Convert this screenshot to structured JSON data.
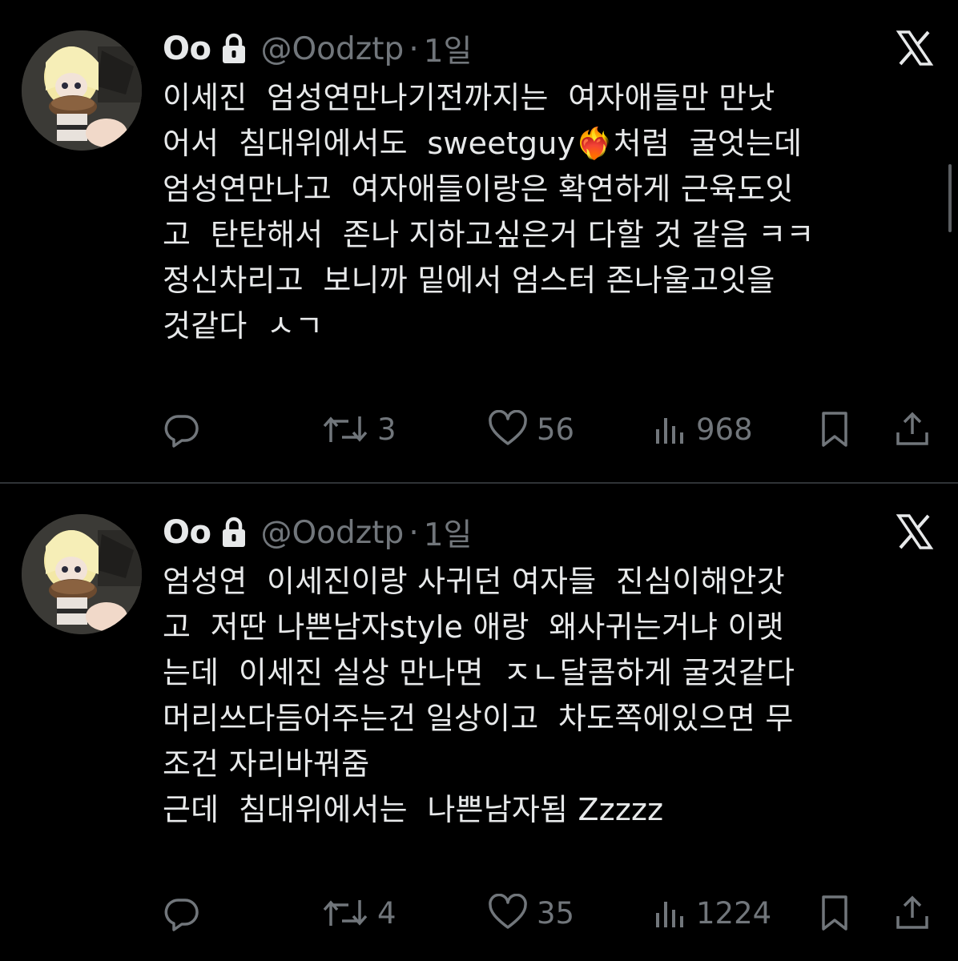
{
  "colors": {
    "background": "#000000",
    "text": "#e7e9ea",
    "muted": "#71767b",
    "divider": "#2f3336"
  },
  "tweets": [
    {
      "display_name": "Oo",
      "handle": "@Oodztp",
      "separator": "·",
      "time": "1일",
      "lines": [
        "이세진  엄성연만나기전까지는  여자애들만 만낫",
        "어서  침대위에서도  sweetguy❤️‍🔥처럼  굴엇는데",
        "엄성연만나고  여자애들이랑은 확연하게 근육도잇",
        "고  탄탄해서  존나 지하고싶은거 다할 것 같음 ㅋㅋ",
        "정신차리고  보니까 밑에서 엄스터 존나울고잇을",
        "것같다  ㅅㄱ"
      ],
      "stats": {
        "replies": "",
        "retweets": "3",
        "likes": "56",
        "views": "968"
      }
    },
    {
      "display_name": "Oo",
      "handle": "@Oodztp",
      "separator": "·",
      "time": "1일",
      "lines": [
        "엄성연  이세진이랑 사귀던 여자들  진심이해안갓",
        "고  저딴 나쁜남자style 애랑  왜사귀는거냐 이랫",
        "는데  이세진 실상 만나면  ㅈㄴ달콤하게 굴것같다",
        "머리쓰다듬어주는건 일상이고  차도쪽에있으면 무",
        "조건 자리바꿔줌",
        "근데  침대위에서는  나쁜남자됨 Zzzzz"
      ],
      "stats": {
        "replies": "",
        "retweets": "4",
        "likes": "35",
        "views": "1224"
      }
    }
  ],
  "icons": {
    "lock": "lock-icon",
    "platform_logo": "x-logo-icon",
    "reply": "reply-icon",
    "retweet": "retweet-icon",
    "like": "heart-icon",
    "views": "views-icon",
    "bookmark": "bookmark-icon",
    "share": "share-icon"
  }
}
